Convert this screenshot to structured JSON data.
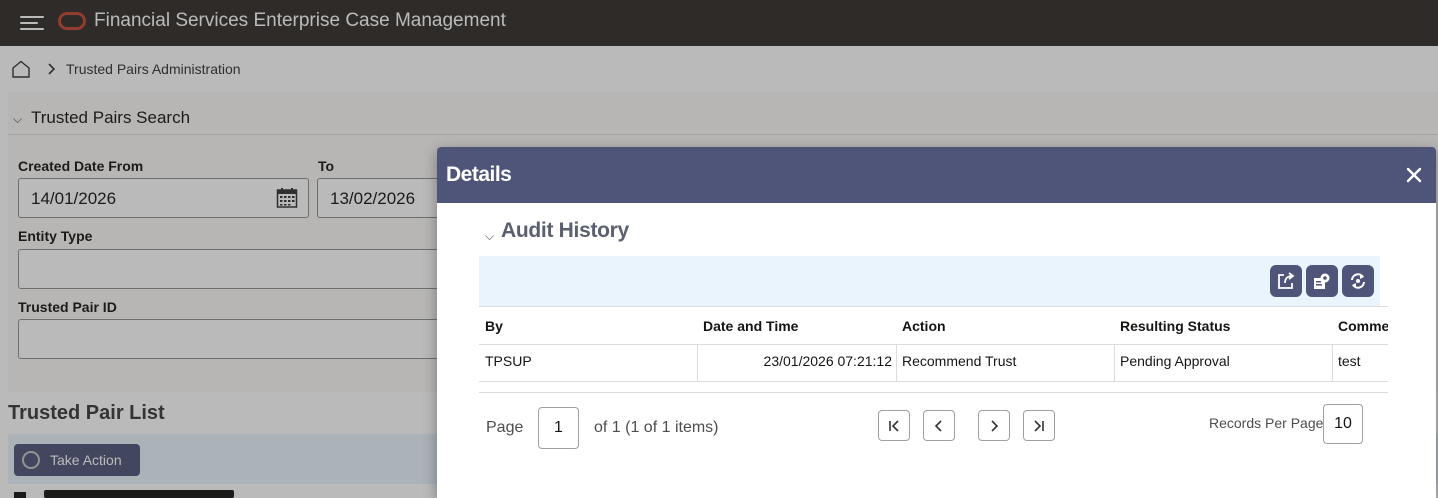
{
  "app": {
    "title": "Financial Services Enterprise Case Management"
  },
  "breadcrumb": {
    "current": "Trusted Pairs Administration"
  },
  "search_panel": {
    "title": "Trusted Pairs Search",
    "created_from_label": "Created Date From",
    "created_from_value": "14/01/2026",
    "to_label": "To",
    "to_value": "13/02/2026",
    "entity_type_label": "Entity Type",
    "entity_type_value": "",
    "trusted_pair_id_label": "Trusted Pair ID",
    "trusted_pair_id_value": ""
  },
  "list": {
    "title": "Trusted Pair List",
    "take_action_label": "Take Action"
  },
  "modal": {
    "title": "Details",
    "section_title": "Audit History",
    "toolbar_icons": [
      "export-icon",
      "settings-icon",
      "refresh-icon"
    ],
    "columns": [
      "By",
      "Date and Time",
      "Action",
      "Resulting Status",
      "Comme"
    ],
    "rows": [
      {
        "by": "TPSUP",
        "date_time": "23/01/2026 07:21:12",
        "action": "Recommend Trust",
        "status": "Pending Approval",
        "comments": "test"
      }
    ],
    "pager": {
      "page_label": "Page",
      "page_value": "1",
      "of_text": "of 1 (1 of 1 items)",
      "records_per_page_label": "Records Per Page",
      "records_per_page_value": "10"
    }
  },
  "colors": {
    "topbar": "#312d2a",
    "modal_header": "#4f5578",
    "toolbar_bg": "#e9f4fd",
    "logo": "#c74634"
  }
}
